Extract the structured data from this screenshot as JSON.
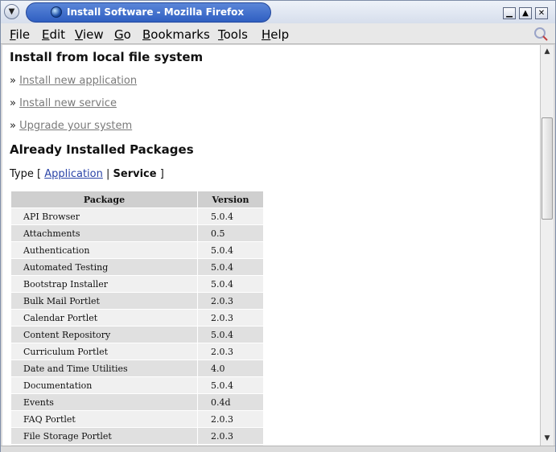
{
  "window": {
    "title": "Install Software - Mozilla Firefox"
  },
  "menubar": {
    "items": [
      {
        "label": "File",
        "accel": "F"
      },
      {
        "label": "Edit",
        "accel": "E"
      },
      {
        "label": "View",
        "accel": "V"
      },
      {
        "label": "Go",
        "accel": "G"
      },
      {
        "label": "Bookmarks",
        "accel": "B"
      },
      {
        "label": "Tools",
        "accel": "T"
      },
      {
        "label": "Help",
        "accel": "H"
      }
    ]
  },
  "page": {
    "install_heading": "Install from local file system",
    "bullet": "»",
    "links": [
      "Install new application",
      "Install new service",
      "Upgrade your system"
    ],
    "installed_heading": "Already Installed Packages",
    "type_filter": {
      "prefix": "Type [",
      "application": "Application",
      "separator": "|",
      "service": "Service",
      "suffix": "]"
    },
    "table": {
      "headers": [
        "Package",
        "Version"
      ],
      "rows": [
        [
          "API Browser",
          "5.0.4"
        ],
        [
          "Attachments",
          "0.5"
        ],
        [
          "Authentication",
          "5.0.4"
        ],
        [
          "Automated Testing",
          "5.0.4"
        ],
        [
          "Bootstrap Installer",
          "5.0.4"
        ],
        [
          "Bulk Mail Portlet",
          "2.0.3"
        ],
        [
          "Calendar Portlet",
          "2.0.3"
        ],
        [
          "Content Repository",
          "5.0.4"
        ],
        [
          "Curriculum Portlet",
          "2.0.3"
        ],
        [
          "Date and Time Utilities",
          "4.0"
        ],
        [
          "Documentation",
          "5.0.4"
        ],
        [
          "Events",
          "0.4d"
        ],
        [
          "FAQ Portlet",
          "2.0.3"
        ],
        [
          "File Storage Portlet",
          "2.0.3"
        ],
        [
          "",
          ""
        ]
      ]
    }
  }
}
